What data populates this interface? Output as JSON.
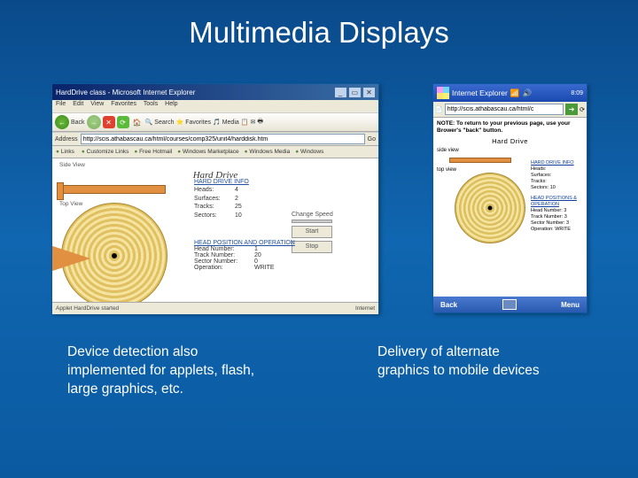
{
  "slide": {
    "title": "Multimedia Displays",
    "caption_left": "Device detection also implemented for applets, flash, large graphics, etc.",
    "caption_right": "Delivery of alternate graphics to mobile devices"
  },
  "ie": {
    "window_title": "HardDrive class - Microsoft Internet Explorer",
    "menu": {
      "file": "File",
      "edit": "Edit",
      "view": "View",
      "favorites": "Favorites",
      "tools": "Tools",
      "help": "Help"
    },
    "toolbar": {
      "back": "Back",
      "search": "Search",
      "favorites": "Favorites",
      "media": "Media"
    },
    "address_label": "Address",
    "url": "http://scis.athabascau.ca/html/courses/comp325/unit4/harddisk.htm",
    "go_label": "Go",
    "links_label": "Links",
    "links": [
      "Customize Links",
      "Free Hotmail",
      "Windows Marketplace",
      "Windows Media",
      "Windows"
    ],
    "status_left": "Applet HardDrive started",
    "status_right": "Internet"
  },
  "hard_drive": {
    "title": "Hard Drive",
    "side_view": "Side View",
    "top_view": "Top View",
    "info_title": "HARD DRIVE INFO",
    "heads_label": "Heads:",
    "heads_value": "4",
    "surfaces_label": "Surfaces:",
    "surfaces_value": "2",
    "tracks_label": "Tracks:",
    "tracks_value": "25",
    "sectors_label": "Sectors:",
    "sectors_value": "10",
    "change_speed": "Change Speed",
    "start": "Start",
    "stop": "Stop",
    "hp_title": "HEAD POSITION AND OPERATION",
    "head_num_label": "Head Number:",
    "head_num_value": "1",
    "track_num_label": "Track Number:",
    "track_num_value": "20",
    "sector_num_label": "Sector Number:",
    "sector_num_value": "0",
    "operation_label": "Operation:",
    "operation_value": "WRITE"
  },
  "mobile": {
    "title": "Internet Explorer",
    "clock": "8:09",
    "url": "http://scis.athabascau.ca/html/c",
    "note": "NOTE: To return to your previous page, use your Brower's \"back\" button.",
    "title_text": "Hard Drive",
    "side_view": "side view",
    "top_view": "top view",
    "info_title": "HARD DRIVE INFO",
    "heads": "Heads:",
    "surfaces": "Surfaces:",
    "tracks": "Tracks:",
    "sectors": "Sectors: 10",
    "hp_title": "HEAD POSITIONS & OPERATION",
    "head_num": "Head Number: 3",
    "track_num": "Track Number: 3",
    "sector_num": "Sector Number: 3",
    "operation": "Operation: WRITE",
    "back": "Back",
    "menu": "Menu"
  }
}
